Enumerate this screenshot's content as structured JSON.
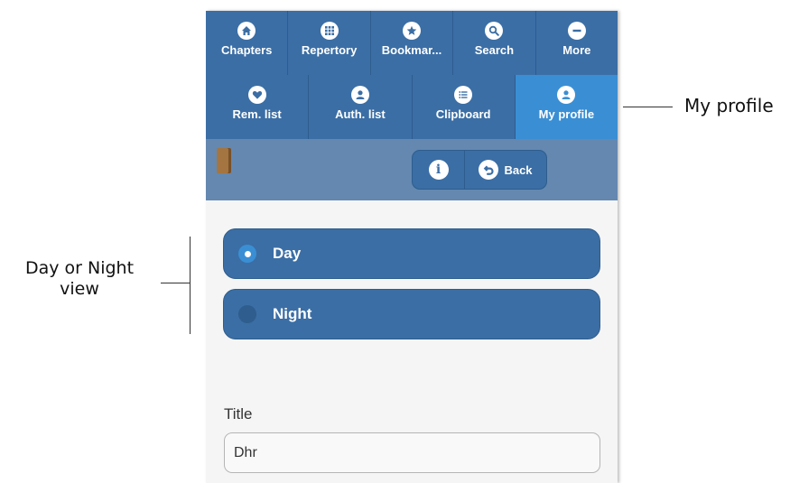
{
  "nav": {
    "row1": [
      {
        "label": "Chapters",
        "icon": "home-icon"
      },
      {
        "label": "Repertory",
        "icon": "grid-icon"
      },
      {
        "label": "Bookmar...",
        "icon": "star-icon"
      },
      {
        "label": "Search",
        "icon": "search-icon"
      },
      {
        "label": "More",
        "icon": "minus-icon"
      }
    ],
    "row2": [
      {
        "label": "Rem. list",
        "icon": "heart-icon"
      },
      {
        "label": "Auth. list",
        "icon": "user-icon"
      },
      {
        "label": "Clipboard",
        "icon": "list-icon"
      },
      {
        "label": "My profile",
        "icon": "user-icon",
        "active": true
      }
    ]
  },
  "toolbar": {
    "info_glyph": "i",
    "back_label": "Back",
    "book_icon": "book-icon"
  },
  "view_mode": {
    "options": [
      "Day",
      "Night"
    ],
    "selected": "Day"
  },
  "form": {
    "title_label": "Title",
    "title_value": "Dhr"
  },
  "annotations": {
    "profile": "My profile",
    "view_line1": "Day or Night",
    "view_line2": "view"
  },
  "colors": {
    "nav_bg": "#3b6ea5",
    "nav_active": "#3a8fd4",
    "toolbar_bg": "#6488b0",
    "content_bg": "#f5f5f5"
  }
}
